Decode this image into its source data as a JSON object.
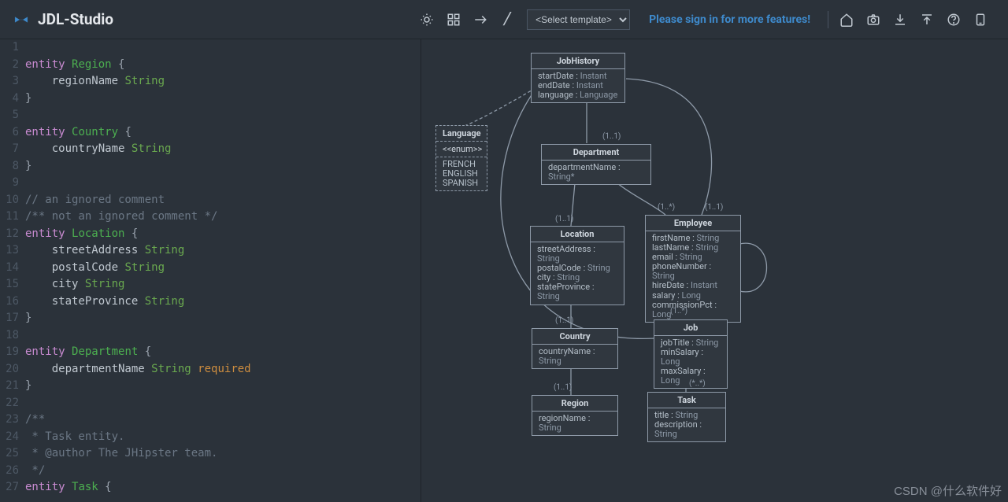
{
  "header": {
    "brand": "JDL-Studio",
    "template_placeholder": "<Select template>",
    "signin": "Please sign in for more features!",
    "icons": [
      "sun",
      "grid",
      "arrow",
      "slash",
      "home",
      "camera",
      "download",
      "upload",
      "help",
      "device"
    ]
  },
  "editor": {
    "lines": [
      {
        "n": 1,
        "raw": ""
      },
      {
        "n": 2,
        "kw": "entity",
        "ent": "Region",
        "suffix": " {"
      },
      {
        "n": 3,
        "indent": true,
        "field": "regionName",
        "type": "String"
      },
      {
        "n": 4,
        "brace_close": true
      },
      {
        "n": 5,
        "raw": ""
      },
      {
        "n": 6,
        "kw": "entity",
        "ent": "Country",
        "suffix": " {"
      },
      {
        "n": 7,
        "indent": true,
        "field": "countryName",
        "type": "String"
      },
      {
        "n": 8,
        "brace_close": true
      },
      {
        "n": 9,
        "raw": ""
      },
      {
        "n": 10,
        "comment": "// an ignored comment"
      },
      {
        "n": 11,
        "comment": "/** not an ignored comment */"
      },
      {
        "n": 12,
        "kw": "entity",
        "ent": "Location",
        "suffix": " {"
      },
      {
        "n": 13,
        "indent": true,
        "field": "streetAddress",
        "type": "String"
      },
      {
        "n": 14,
        "indent": true,
        "field": "postalCode",
        "type": "String"
      },
      {
        "n": 15,
        "indent": true,
        "field": "city",
        "type": "String"
      },
      {
        "n": 16,
        "indent": true,
        "field": "stateProvince",
        "type": "String"
      },
      {
        "n": 17,
        "brace_close": true
      },
      {
        "n": 18,
        "raw": ""
      },
      {
        "n": 19,
        "kw": "entity",
        "ent": "Department",
        "suffix": " {"
      },
      {
        "n": 20,
        "indent": true,
        "field": "departmentName",
        "type": "String",
        "mod": "required"
      },
      {
        "n": 21,
        "brace_close": true
      },
      {
        "n": 22,
        "raw": ""
      },
      {
        "n": 23,
        "comment": "/**"
      },
      {
        "n": 24,
        "comment": " * Task entity."
      },
      {
        "n": 25,
        "comment": " * @author The JHipster team."
      },
      {
        "n": 26,
        "comment": " */"
      },
      {
        "n": 27,
        "kw": "entity",
        "ent": "Task",
        "suffix": " {"
      }
    ]
  },
  "diagram": {
    "entities": {
      "JobHistory": {
        "title": "JobHistory",
        "fields": [
          [
            "startDate",
            "Instant"
          ],
          [
            "endDate",
            "Instant"
          ],
          [
            "language",
            "Language"
          ]
        ]
      },
      "Language": {
        "title": "Language",
        "enum_tag": "<<enum>>",
        "values": [
          "FRENCH",
          "ENGLISH",
          "SPANISH"
        ]
      },
      "Department": {
        "title": "Department",
        "fields": [
          [
            "departmentName",
            "String*"
          ]
        ]
      },
      "Location": {
        "title": "Location",
        "fields": [
          [
            "streetAddress",
            "String"
          ],
          [
            "postalCode",
            "String"
          ],
          [
            "city",
            "String"
          ],
          [
            "stateProvince",
            "String"
          ]
        ]
      },
      "Employee": {
        "title": "Employee",
        "fields": [
          [
            "firstName",
            "String"
          ],
          [
            "lastName",
            "String"
          ],
          [
            "email",
            "String"
          ],
          [
            "phoneNumber",
            "String"
          ],
          [
            "hireDate",
            "Instant"
          ],
          [
            "salary",
            "Long"
          ],
          [
            "commissionPct",
            "Long"
          ]
        ]
      },
      "Job": {
        "title": "Job",
        "fields": [
          [
            "jobTitle",
            "String"
          ],
          [
            "minSalary",
            "Long"
          ],
          [
            "maxSalary",
            "Long"
          ]
        ]
      },
      "Task": {
        "title": "Task",
        "fields": [
          [
            "title",
            "String"
          ],
          [
            "description",
            "String"
          ]
        ]
      },
      "Country": {
        "title": "Country",
        "fields": [
          [
            "countryName",
            "String"
          ]
        ]
      },
      "Region": {
        "title": "Region",
        "fields": [
          [
            "regionName",
            "String"
          ]
        ]
      }
    },
    "cardinalities": {
      "jh_dep": "(1..1)",
      "dep_loc": "(1..1)",
      "dep_emp": "(1..*)",
      "jh_emp": "(1..1)",
      "loc_ctry": "(1..1)",
      "emp_job": "(1..*)",
      "job_task": "(*..*)",
      "ctry_reg": "(1..1)"
    }
  },
  "watermark": "CSDN @什么软件好"
}
